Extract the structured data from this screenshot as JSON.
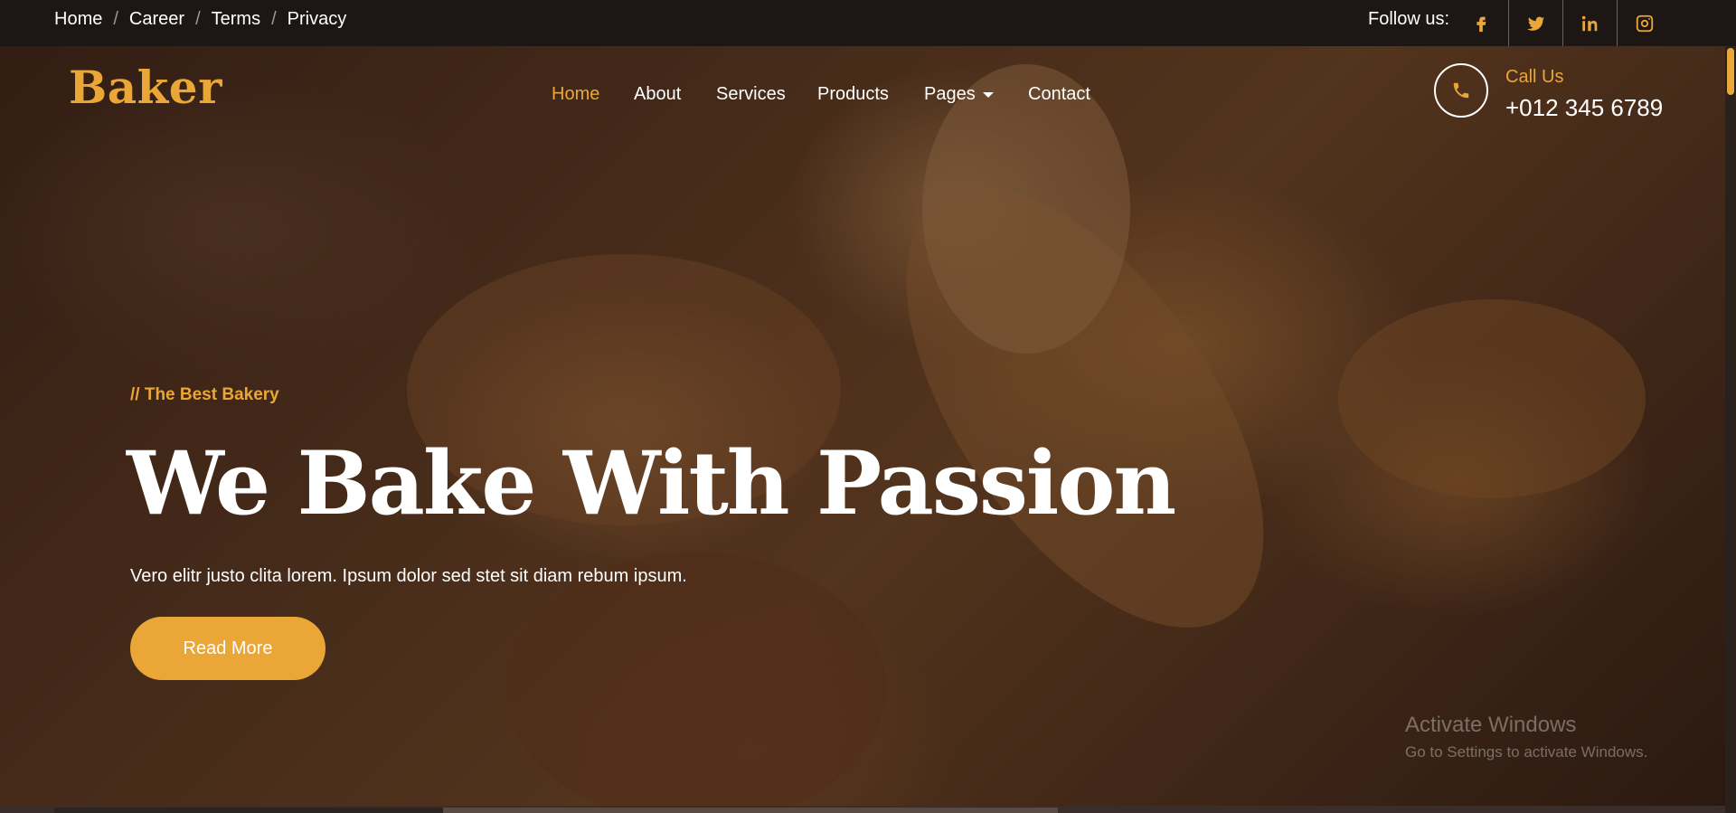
{
  "topbar": {
    "links": [
      "Home",
      "Career",
      "Terms",
      "Privacy"
    ],
    "separator": "/",
    "follow_label": "Follow us:",
    "social_icons": [
      "facebook-icon",
      "twitter-icon",
      "linkedin-icon",
      "instagram-icon"
    ]
  },
  "brand": {
    "name": "Baker",
    "accent_color": "#eaa636"
  },
  "nav": {
    "items": [
      "Home",
      "About",
      "Services",
      "Products",
      "Pages",
      "Contact"
    ],
    "active": "Home"
  },
  "contact": {
    "label": "Call Us",
    "phone": "+012 345 6789"
  },
  "hero": {
    "tagline": "// The Best Bakery",
    "headline": "We Bake With Passion",
    "subtext": "Vero elitr justo clita lorem. Ipsum dolor sed stet sit diam rebum ipsum.",
    "button_label": "Read More"
  },
  "overlay": {
    "watermark_title": "Activate Windows",
    "watermark_sub": "Go to Settings to activate Windows."
  }
}
